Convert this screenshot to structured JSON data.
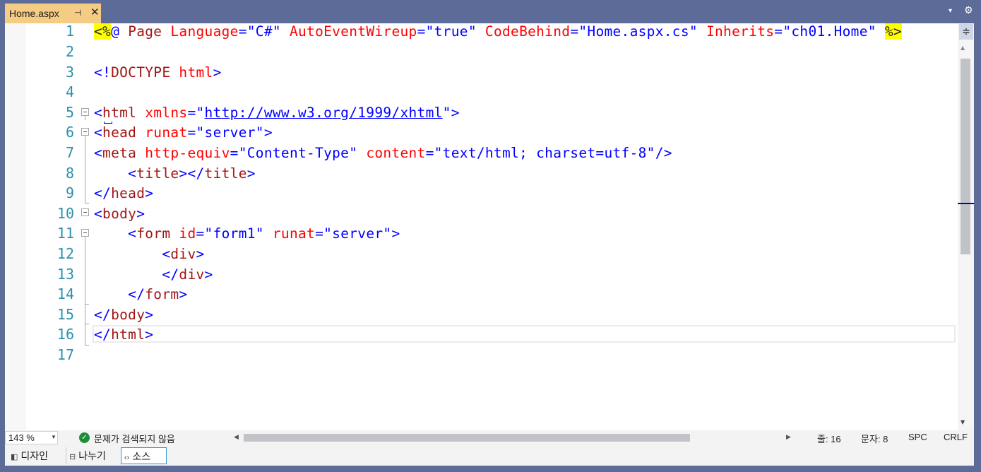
{
  "tab": {
    "title": "Home.aspx",
    "pin_icon": "⊣",
    "close_icon": "✕"
  },
  "toolbar_right": {
    "dropdown_icon": "▾",
    "gear_icon": "⚙"
  },
  "editor": {
    "line_numbers": [
      "1",
      "2",
      "3",
      "4",
      "5",
      "6",
      "7",
      "8",
      "9",
      "10",
      "11",
      "12",
      "13",
      "14",
      "15",
      "16",
      "17"
    ],
    "current_line": 16
  },
  "code": {
    "l1": [
      {
        "t": "<%",
        "c": "hl"
      },
      {
        "t": "@ ",
        "c": "blue"
      },
      {
        "t": "Page ",
        "c": "maroon"
      },
      {
        "t": "Language",
        "c": "red"
      },
      {
        "t": "=",
        "c": "blue"
      },
      {
        "t": "\"C#\" ",
        "c": "blue"
      },
      {
        "t": "AutoEventWireup",
        "c": "red"
      },
      {
        "t": "=",
        "c": "blue"
      },
      {
        "t": "\"true\" ",
        "c": "blue"
      },
      {
        "t": "CodeBehind",
        "c": "red"
      },
      {
        "t": "=",
        "c": "blue"
      },
      {
        "t": "\"Home.aspx.cs\" ",
        "c": "blue"
      },
      {
        "t": "Inherits",
        "c": "red"
      },
      {
        "t": "=",
        "c": "blue"
      },
      {
        "t": "\"ch01.Home\" ",
        "c": "blue"
      },
      {
        "t": "%>",
        "c": "hl"
      }
    ],
    "l3": [
      {
        "t": "<!",
        "c": "blue"
      },
      {
        "t": "DOCTYPE ",
        "c": "maroon"
      },
      {
        "t": "html",
        "c": "red"
      },
      {
        "t": ">",
        "c": "blue"
      }
    ],
    "l5": [
      {
        "t": "<",
        "c": "blue"
      },
      {
        "t": "html ",
        "c": "maroon"
      },
      {
        "t": "xmlns",
        "c": "red"
      },
      {
        "t": "=\"",
        "c": "blue"
      },
      {
        "t": "http://www.w3.org/1999/xhtml",
        "c": "link"
      },
      {
        "t": "\">",
        "c": "blue"
      }
    ],
    "l6": [
      {
        "t": "<",
        "c": "blue"
      },
      {
        "t": "head ",
        "c": "maroon"
      },
      {
        "t": "runat",
        "c": "red"
      },
      {
        "t": "=",
        "c": "blue"
      },
      {
        "t": "\"server\"",
        "c": "blue"
      },
      {
        "t": ">",
        "c": "blue"
      }
    ],
    "l7": [
      {
        "t": "<",
        "c": "blue"
      },
      {
        "t": "meta ",
        "c": "maroon"
      },
      {
        "t": "http-equiv",
        "c": "red"
      },
      {
        "t": "=",
        "c": "blue"
      },
      {
        "t": "\"Content-Type\" ",
        "c": "blue"
      },
      {
        "t": "content",
        "c": "red"
      },
      {
        "t": "=",
        "c": "blue"
      },
      {
        "t": "\"text/html; charset=utf-8\"",
        "c": "blue"
      },
      {
        "t": "/>",
        "c": "blue"
      }
    ],
    "l8": [
      {
        "t": "    <",
        "c": "blue"
      },
      {
        "t": "title",
        "c": "maroon"
      },
      {
        "t": "></",
        "c": "blue"
      },
      {
        "t": "title",
        "c": "maroon"
      },
      {
        "t": ">",
        "c": "blue"
      }
    ],
    "l9": [
      {
        "t": "</",
        "c": "blue"
      },
      {
        "t": "head",
        "c": "maroon"
      },
      {
        "t": ">",
        "c": "blue"
      }
    ],
    "l10": [
      {
        "t": "<",
        "c": "blue"
      },
      {
        "t": "body",
        "c": "maroon"
      },
      {
        "t": ">",
        "c": "blue"
      }
    ],
    "l11": [
      {
        "t": "    <",
        "c": "blue"
      },
      {
        "t": "form ",
        "c": "maroon"
      },
      {
        "t": "id",
        "c": "red"
      },
      {
        "t": "=",
        "c": "blue"
      },
      {
        "t": "\"form1\" ",
        "c": "blue"
      },
      {
        "t": "runat",
        "c": "red"
      },
      {
        "t": "=",
        "c": "blue"
      },
      {
        "t": "\"server\"",
        "c": "blue"
      },
      {
        "t": ">",
        "c": "blue"
      }
    ],
    "l12": [
      {
        "t": "        <",
        "c": "blue"
      },
      {
        "t": "div",
        "c": "maroon"
      },
      {
        "t": ">",
        "c": "blue"
      }
    ],
    "l13": [
      {
        "t": "        </",
        "c": "blue"
      },
      {
        "t": "div",
        "c": "maroon"
      },
      {
        "t": ">",
        "c": "blue"
      }
    ],
    "l14": [
      {
        "t": "    </",
        "c": "blue"
      },
      {
        "t": "form",
        "c": "maroon"
      },
      {
        "t": ">",
        "c": "blue"
      }
    ],
    "l15": [
      {
        "t": "</",
        "c": "blue"
      },
      {
        "t": "body",
        "c": "maroon"
      },
      {
        "t": ">",
        "c": "blue"
      }
    ],
    "l16": [
      {
        "t": "</",
        "c": "blue"
      },
      {
        "t": "html",
        "c": "maroon"
      },
      {
        "t": ">",
        "c": "blue"
      }
    ]
  },
  "scrollbar": {
    "split_icon": "≑",
    "up_icon": "▲",
    "down_icon": "▼"
  },
  "status": {
    "zoom": "143 %",
    "zoom_arrow": "▼",
    "issues_icon": "✓",
    "issues_text": "문제가 검색되지 않음",
    "hscroll_left": "◀",
    "hscroll_right": "▶",
    "line": "줄: 16",
    "col": "문자: 8",
    "spc": "SPC",
    "crlf": "CRLF"
  },
  "view_tabs": {
    "design": {
      "icon": "◧",
      "label": "디자인"
    },
    "split": {
      "icon": "⊟",
      "label": "나누기"
    },
    "source": {
      "icon": "‹›",
      "label": "소스"
    }
  },
  "colors": {
    "chrome": "#5d6b99",
    "active_tab": "#f5cc84",
    "keyword_blue": "#0000ff",
    "element_maroon": "#a31515",
    "attribute_red": "#ff0000",
    "line_number": "#2b91af",
    "highlight": "#ffff00"
  }
}
